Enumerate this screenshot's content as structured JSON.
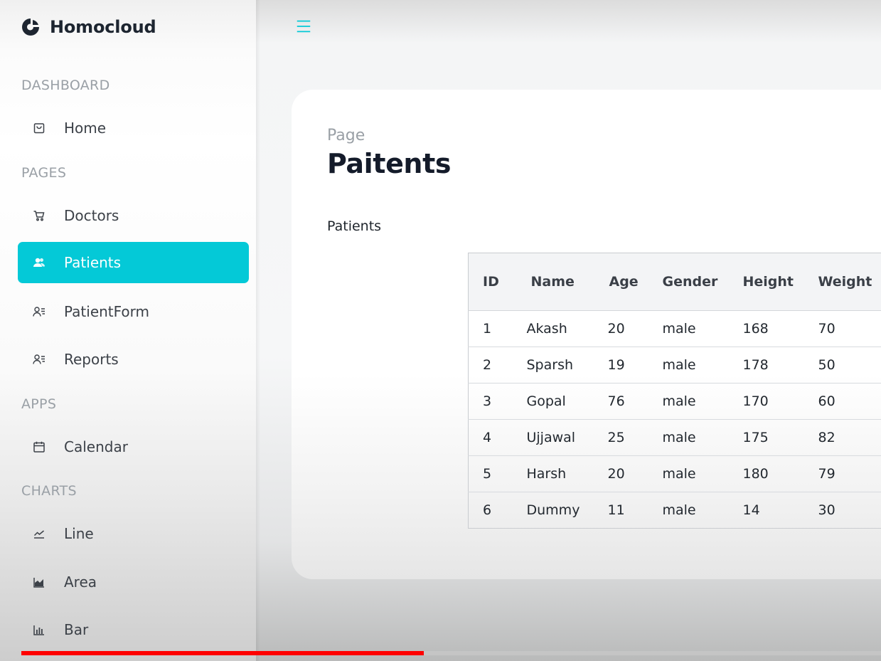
{
  "brand": {
    "name": "Homocloud",
    "logo_icon": "homocloud-logo-icon"
  },
  "sidebar": {
    "sections": [
      {
        "title": "DASHBOARD"
      },
      {
        "title": "PAGES"
      },
      {
        "title": "APPS"
      },
      {
        "title": "CHARTS"
      }
    ],
    "items": [
      {
        "label": "Home",
        "icon": "shopping-bag-icon"
      },
      {
        "label": "Doctors",
        "icon": "shopping-cart-icon"
      },
      {
        "label": "Patients",
        "icon": "users-icon",
        "active": true
      },
      {
        "label": "PatientForm",
        "icon": "user-list-icon"
      },
      {
        "label": "Reports",
        "icon": "user-list-icon"
      },
      {
        "label": "Calendar",
        "icon": "calendar-icon"
      },
      {
        "label": "Line",
        "icon": "line-chart-icon"
      },
      {
        "label": "Area",
        "icon": "area-chart-icon"
      },
      {
        "label": "Bar",
        "icon": "bar-chart-icon"
      }
    ]
  },
  "header": {
    "menu_icon": "hamburger-menu-icon"
  },
  "main": {
    "kicker": "Page",
    "title": "Paitents",
    "table_caption": "Patients",
    "table": {
      "columns": [
        "ID",
        "Name",
        "Age",
        "Gender",
        "Height",
        "Weight"
      ],
      "rows": [
        [
          "1",
          "Akash",
          "20",
          "male",
          "168",
          "70"
        ],
        [
          "2",
          "Sparsh",
          "19",
          "male",
          "178",
          "50"
        ],
        [
          "3",
          "Gopal",
          "76",
          "male",
          "170",
          "60"
        ],
        [
          "4",
          "Ujjawal",
          "25",
          "male",
          "175",
          "82"
        ],
        [
          "5",
          "Harsh",
          "20",
          "male",
          "180",
          "79"
        ],
        [
          "6",
          "Dummy",
          "11",
          "male",
          "14",
          "30"
        ]
      ]
    }
  },
  "video_progress": {
    "fraction": 0.468
  },
  "colors": {
    "accent": "#04c9d7",
    "progress": "#ff0000",
    "title": "#141b2a"
  }
}
